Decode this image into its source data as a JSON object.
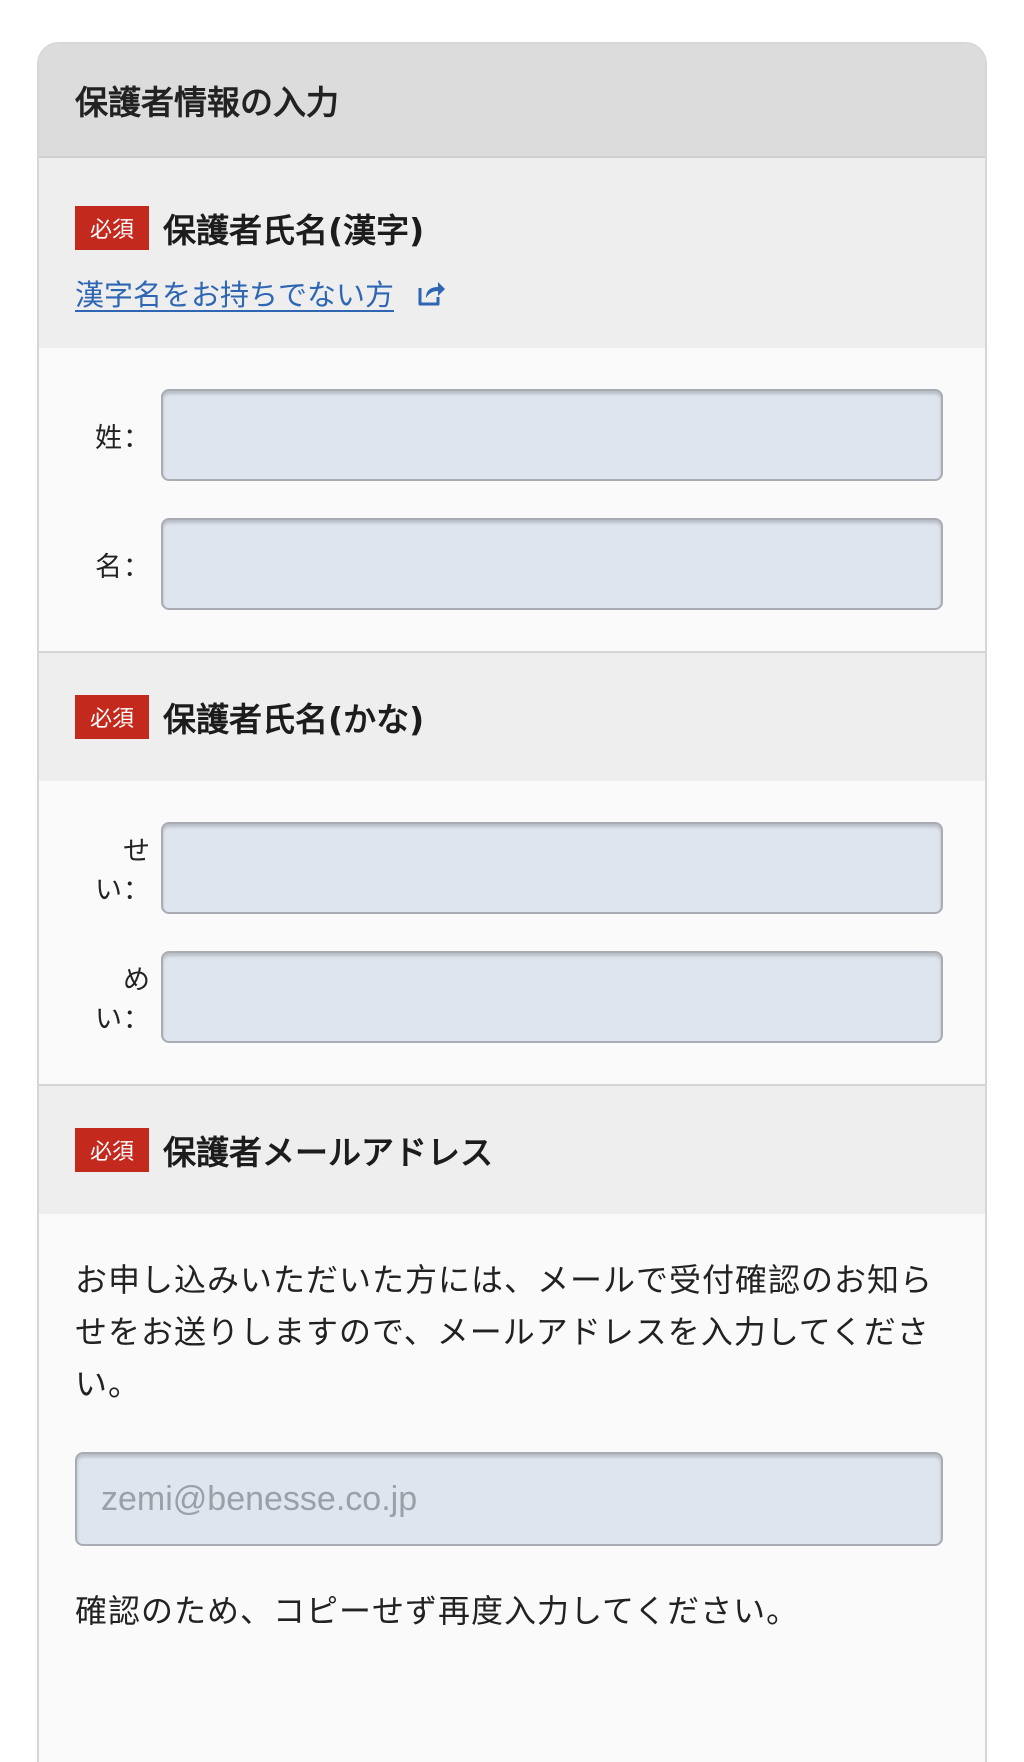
{
  "card": {
    "title": "保護者情報の入力"
  },
  "badges": {
    "required": "必須"
  },
  "kanji_section": {
    "title": "保護者氏名(漢字)",
    "help_link": "漢字名をお持ちでない方",
    "help_link_icon": "external-link-icon",
    "fields": [
      {
        "label": "姓：",
        "value": ""
      },
      {
        "label": "名：",
        "value": ""
      }
    ]
  },
  "kana_section": {
    "title": "保護者氏名(かな)",
    "fields": [
      {
        "label": "せい：",
        "value": ""
      },
      {
        "label": "めい：",
        "value": ""
      }
    ]
  },
  "email_section": {
    "title": "保護者メールアドレス",
    "description": "お申し込みいただいた方には、メールで受付確認のお知らせをお送りしますので、メールアドレスを入力してください。",
    "placeholder": "zemi@benesse.co.jp",
    "confirm_note": "確認のため、コピーせず再度入力してください。"
  },
  "colors": {
    "required_badge": "#c4291d",
    "link": "#2f66b3",
    "input_bg": "#dfe5ee",
    "header_bg": "#dcdcdc",
    "section_head_bg": "#eeeeee"
  }
}
